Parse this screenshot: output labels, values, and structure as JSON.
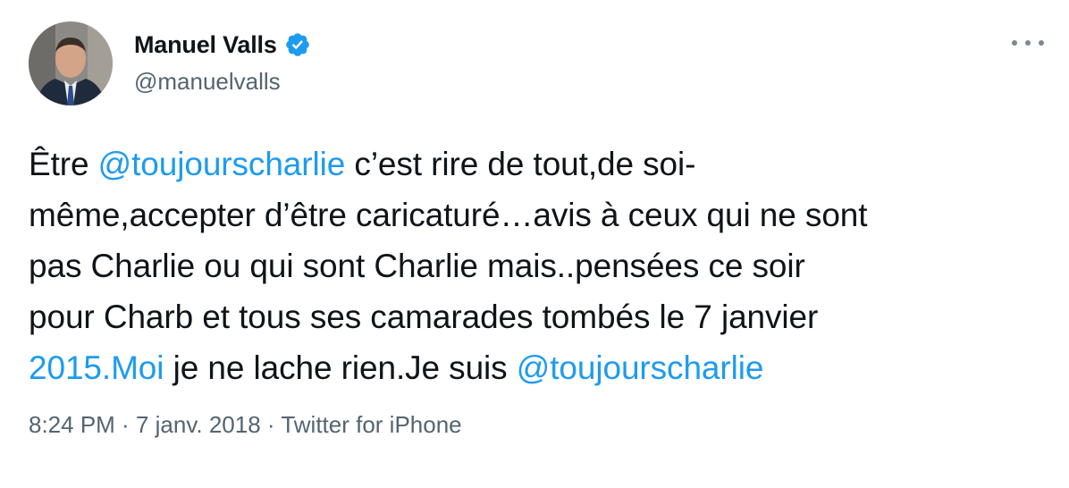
{
  "author": {
    "display_name": "Manuel Valls",
    "handle": "@manuelvalls",
    "verified_icon": "verified-badge-icon"
  },
  "tweet": {
    "lines": [
      [
        {
          "text": "Être ",
          "link": false
        },
        {
          "text": "@toujourscharlie",
          "link": true
        },
        {
          "text": " c’est rire de tout,de soi-",
          "link": false
        }
      ],
      [
        {
          "text": "même,accepter d’être caricaturé…avis à ceux qui ne sont",
          "link": false
        }
      ],
      [
        {
          "text": "pas Charlie ou qui sont Charlie mais..pensées ce soir",
          "link": false
        }
      ],
      [
        {
          "text": "pour Charb et tous ses camarades tombés le 7 janvier",
          "link": false
        }
      ],
      [
        {
          "text": "2015.Moi",
          "link": true
        },
        {
          "text": " je ne lache rien.Je suis ",
          "link": false
        },
        {
          "text": "@toujourscharlie",
          "link": true
        }
      ]
    ]
  },
  "meta": {
    "time": "8:24 PM",
    "separator": " · ",
    "date": "7 janv. 2018",
    "source": "Twitter for iPhone"
  },
  "colors": {
    "link": "#1d9bf0",
    "text": "#0f1419",
    "muted": "#536471"
  }
}
